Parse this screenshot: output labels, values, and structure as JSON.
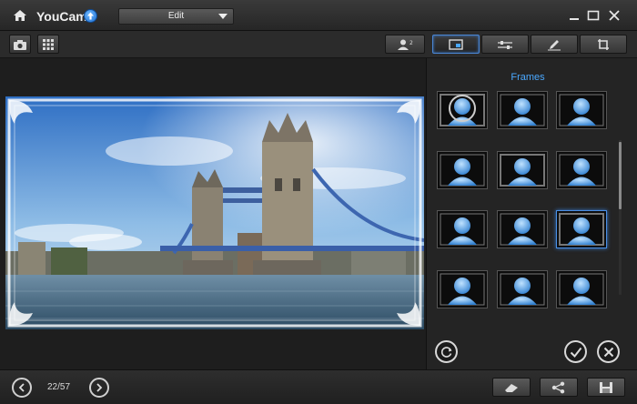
{
  "app": {
    "title": "YouCam"
  },
  "mode_select": {
    "value": "Edit"
  },
  "frames_panel": {
    "title": "Frames",
    "selected_index": 8,
    "thumbnail_count": 12
  },
  "navigation": {
    "counter": "22/57"
  },
  "colors": {
    "accent": "#4aa8ff",
    "selection": "#4a8fe6",
    "update_badge": "#1f6fd0"
  },
  "icons": {
    "titlebar": [
      "home-icon",
      "update-icon",
      "minimize-icon",
      "maximize-icon",
      "close-icon"
    ],
    "toolbar": [
      "camera-icon",
      "grid-view-icon",
      "face-login-icon",
      "frames-effect-icon",
      "adjust-icon",
      "draw-icon",
      "crop-icon"
    ],
    "panel": [
      "refresh-icon",
      "apply-icon",
      "cancel-icon"
    ],
    "bottom": [
      "previous-icon",
      "next-icon",
      "eraser-icon",
      "share-icon",
      "save-icon"
    ]
  }
}
